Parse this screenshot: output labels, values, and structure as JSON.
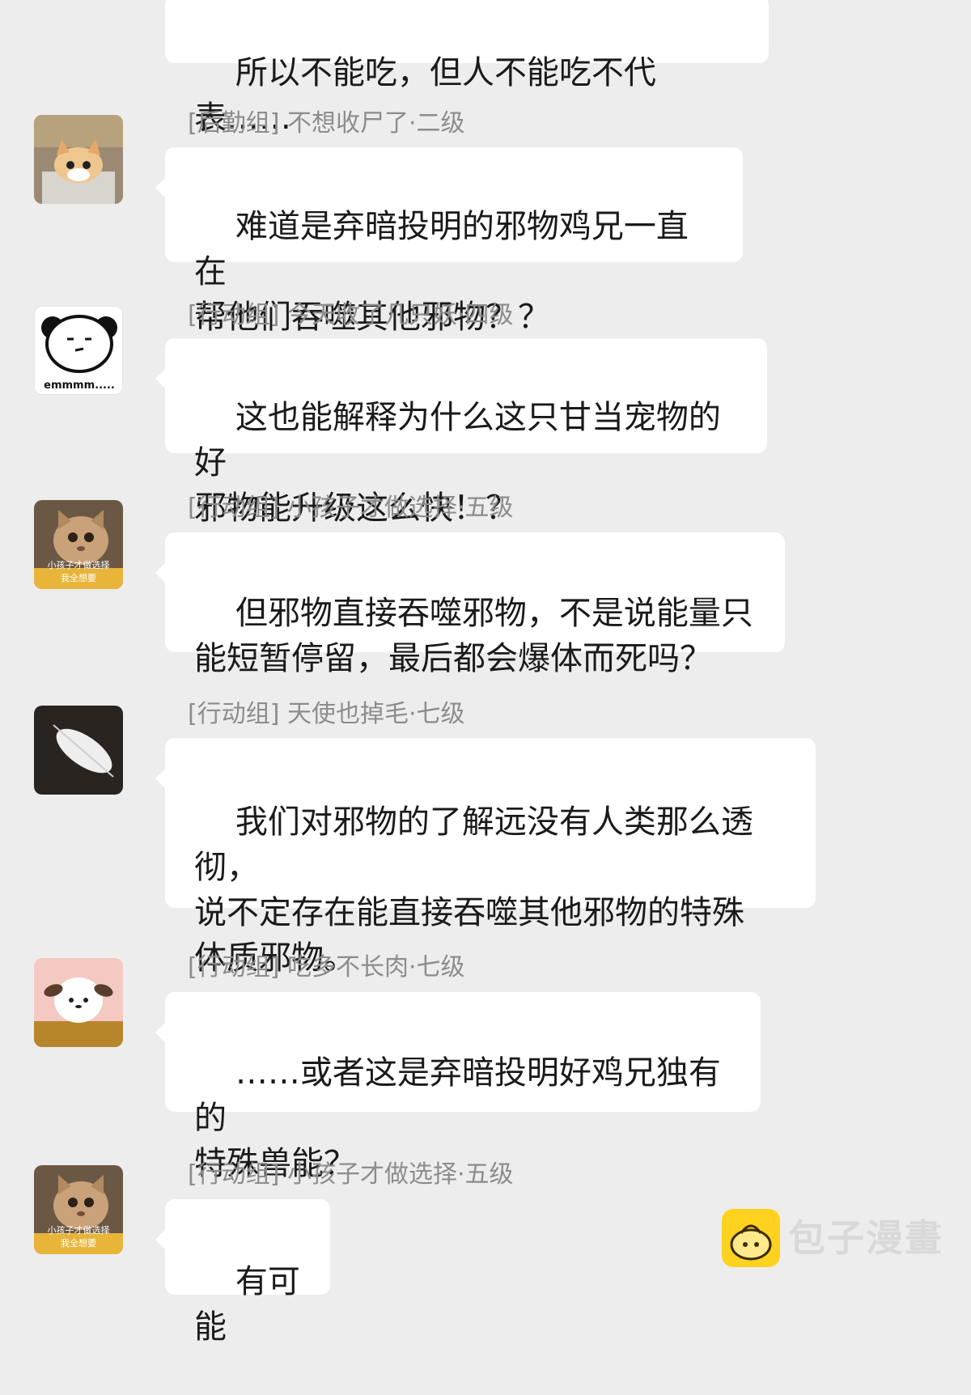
{
  "messages": [
    {
      "sender": "",
      "text": "所以不能吃，但人不能吃不代表……"
    },
    {
      "sender": "[后勤组] 不想收尸了·二级",
      "avatar_icon": "kitten-in-box-avatar",
      "text": "难道是弃暗投明的邪物鸡兄一直在\n帮他们吞噬其他邪物？？"
    },
    {
      "sender": "[行动组] 今天收了几只妖·四级",
      "avatar_icon": "panda-meme-avatar",
      "avatar_caption": "emmmm.....",
      "text": "这也能解释为什么这只甘当宠物的好\n邪物能升级这么快！？"
    },
    {
      "sender": "[行动组] 小孩子才做选择·五级",
      "avatar_icon": "cat-meme-avatar",
      "avatar_caption": "小孩子才做选择\n我全想要",
      "text": "但邪物直接吞噬邪物，不是说能量只\n能短暂停留，最后都会爆体而死吗？"
    },
    {
      "sender": "[行动组] 天使也掉毛·七级",
      "avatar_icon": "feather-avatar",
      "text": "我们对邪物的了解远没有人类那么透彻，\n说不定存在能直接吞噬其他邪物的特殊\n体质邪物。"
    },
    {
      "sender": "[行动组] 吃多不长肉·七级",
      "avatar_icon": "puppy-dessert-avatar",
      "text": "……或者这是弃暗投明好鸡兄独有的\n特殊兽能？"
    },
    {
      "sender": "[行动组] 小孩子才做选择·五级",
      "avatar_icon": "cat-meme-avatar",
      "avatar_caption": "小孩子才做选择\n我全想要",
      "text": "有可能"
    }
  ],
  "watermark": {
    "text": "包子漫畫",
    "icon": "bun-logo-icon"
  }
}
